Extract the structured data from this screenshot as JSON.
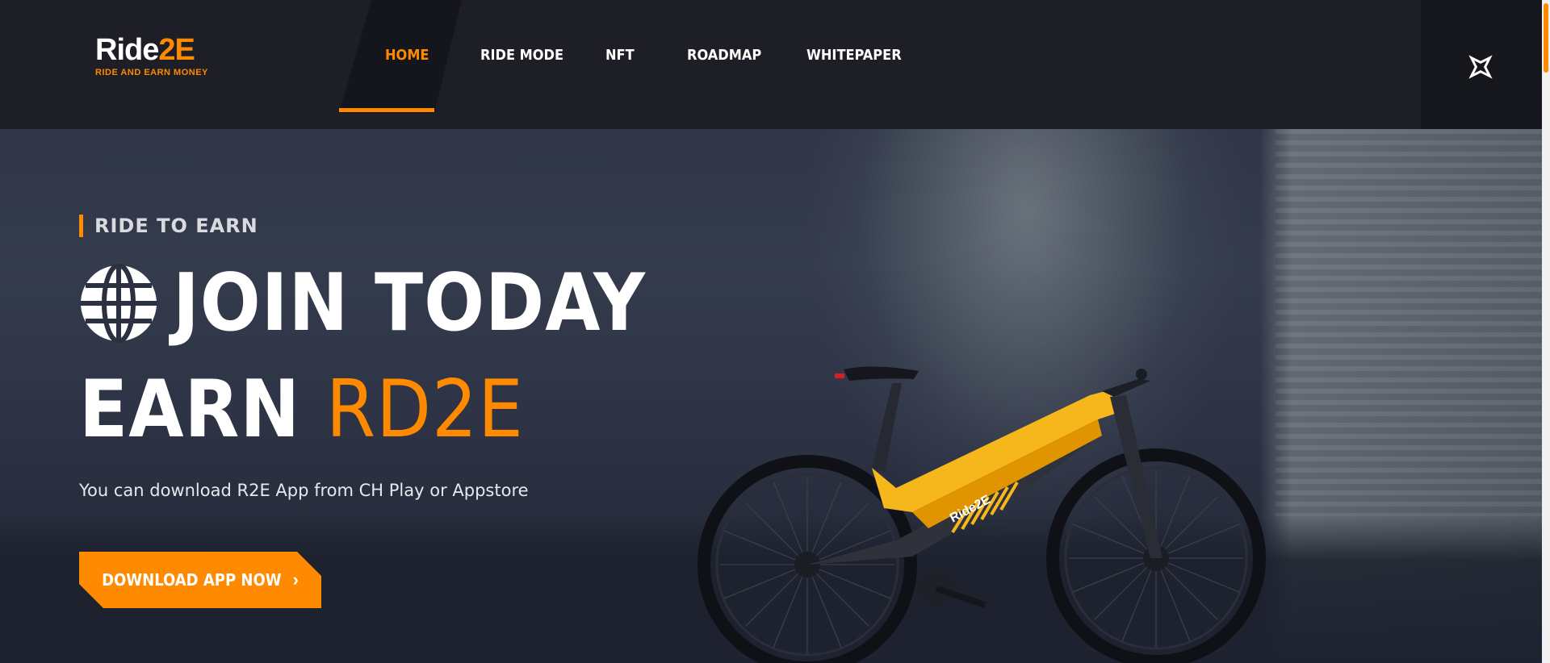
{
  "brand": {
    "logo_main": "Ride",
    "logo_accent": "2E",
    "tagline": "RIDE AND EARN MONEY"
  },
  "nav": {
    "items": [
      {
        "label": "HOME",
        "active": true
      },
      {
        "label": "RIDE MODE",
        "active": false
      },
      {
        "label": "NFT",
        "active": false
      },
      {
        "label": "ROADMAP",
        "active": false
      },
      {
        "label": "WHITEPAPER",
        "active": false
      }
    ],
    "close_icon": "close-x-icon"
  },
  "hero": {
    "eyebrow": "RIDE TO EARN",
    "headline_line1": "JOIN TODAY",
    "headline_line2_prefix": "EARN",
    "headline_line2_accent": "RD2E",
    "subtitle": "You can download R2E App from CH Play or Appstore",
    "cta_label": "DOWNLOAD APP NOW",
    "cta_icon": "chevron-right-icon",
    "bike_logo": "Ride2E"
  },
  "colors": {
    "accent": "#ff8a00",
    "header_bg": "#1d1e26",
    "text_light": "#ffffff"
  }
}
